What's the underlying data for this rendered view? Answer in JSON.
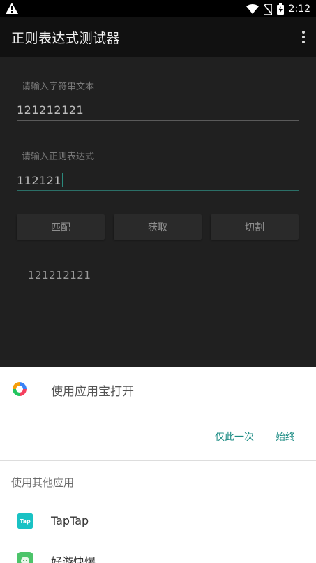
{
  "status_bar": {
    "time": "2:12",
    "icons": [
      "warning-icon",
      "wifi-icon",
      "no-sim-icon",
      "battery-charging-icon"
    ]
  },
  "app_bar": {
    "title": "正则表达式测试器",
    "overflow_icon": "more-vertical-icon"
  },
  "form": {
    "text_label": "请输入字符串文本",
    "text_value": "121212121",
    "regex_label": "请输入正则表达式",
    "regex_value": "112121",
    "buttons": [
      "匹配",
      "获取",
      "切割"
    ],
    "result": "121212121"
  },
  "chooser": {
    "primary_app": "使用应用宝打开",
    "just_once": "仅此一次",
    "always": "始终",
    "other_apps_header": "使用其他应用",
    "apps": [
      {
        "label": "TapTap",
        "icon_text": "Tap",
        "color": "#19c2c4"
      },
      {
        "label": "好游快爆",
        "color": "#4cc46a"
      }
    ]
  },
  "colors": {
    "accent": "#1e8d85"
  }
}
